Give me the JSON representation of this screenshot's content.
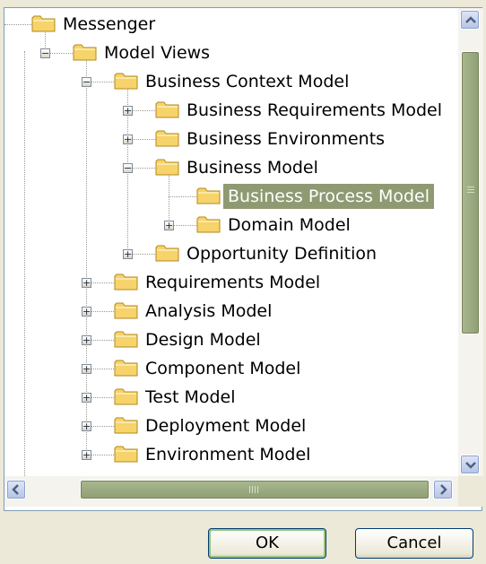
{
  "tree": {
    "nodes": [
      {
        "label": "Messenger",
        "level": 0,
        "toggle": "none",
        "selected": false
      },
      {
        "label": "Model Views",
        "level": 1,
        "toggle": "minus",
        "selected": false
      },
      {
        "label": "Business Context Model",
        "level": 2,
        "toggle": "minus",
        "selected": false
      },
      {
        "label": "Business Requirements Model",
        "level": 3,
        "toggle": "plus",
        "selected": false
      },
      {
        "label": "Business Environments",
        "level": 3,
        "toggle": "plus",
        "selected": false
      },
      {
        "label": "Business Model",
        "level": 3,
        "toggle": "minus",
        "selected": false
      },
      {
        "label": "Business Process Model",
        "level": 4,
        "toggle": "none",
        "selected": true
      },
      {
        "label": "Domain Model",
        "level": 4,
        "toggle": "plus",
        "selected": false
      },
      {
        "label": "Opportunity Definition",
        "level": 3,
        "toggle": "plus",
        "selected": false
      },
      {
        "label": "Requirements Model",
        "level": 2,
        "toggle": "plus",
        "selected": false
      },
      {
        "label": "Analysis Model",
        "level": 2,
        "toggle": "plus",
        "selected": false
      },
      {
        "label": "Design Model",
        "level": 2,
        "toggle": "plus",
        "selected": false
      },
      {
        "label": "Component Model",
        "level": 2,
        "toggle": "plus",
        "selected": false
      },
      {
        "label": "Test Model",
        "level": 2,
        "toggle": "plus",
        "selected": false
      },
      {
        "label": "Deployment Model",
        "level": 2,
        "toggle": "plus",
        "selected": false
      },
      {
        "label": "Environment Model",
        "level": 2,
        "toggle": "plus",
        "selected": false
      }
    ]
  },
  "buttons": {
    "ok_label": "OK",
    "cancel_label": "Cancel"
  },
  "colors": {
    "selection": "#8f9a72",
    "folder": "#f6d36b",
    "scrollbar_thumb": "#9aa97e"
  }
}
